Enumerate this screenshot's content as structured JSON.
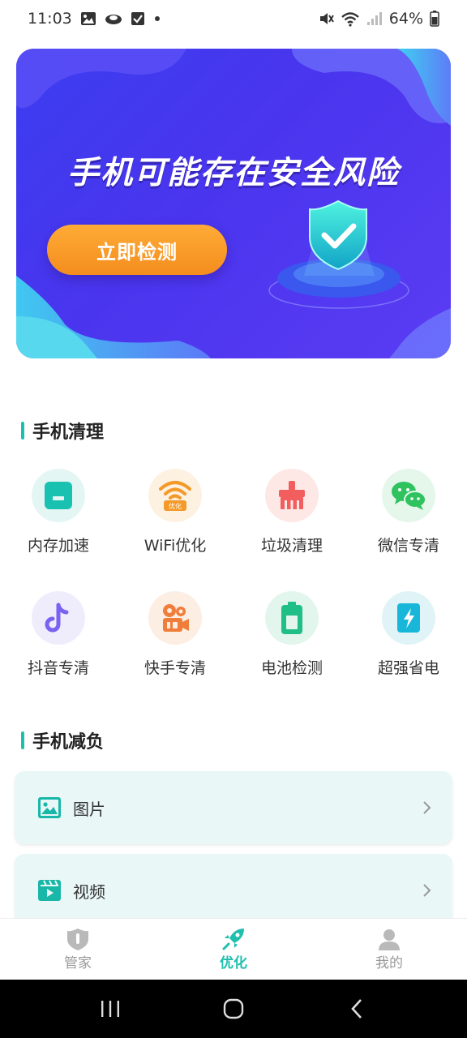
{
  "status_bar": {
    "time": "11:03",
    "battery_percent": "64%"
  },
  "banner": {
    "title": "手机可能存在安全风险",
    "button_label": "立即检测"
  },
  "sections": {
    "cleanup_title": "手机清理",
    "slim_title": "手机减负"
  },
  "tools": [
    {
      "label": "内存加速",
      "icon": "memory-icon",
      "color": "#19c2b0"
    },
    {
      "label": "WiFi优化",
      "icon": "wifi-icon",
      "color": "#f39a2a"
    },
    {
      "label": "垃圾清理",
      "icon": "broom-icon",
      "color": "#f25d5d"
    },
    {
      "label": "微信专清",
      "icon": "wechat-icon",
      "color": "#2ec35e"
    },
    {
      "label": "抖音专清",
      "icon": "tiktok-icon",
      "color": "#7a63f0"
    },
    {
      "label": "快手专清",
      "icon": "kuaishou-icon",
      "color": "#f07d3a"
    },
    {
      "label": "电池检测",
      "icon": "battery-icon",
      "color": "#1fbf86"
    },
    {
      "label": "超强省电",
      "icon": "power-save-icon",
      "color": "#18b6d8"
    }
  ],
  "tools_icon_text": {
    "wifi_badge": "优化"
  },
  "cards": [
    {
      "label": "图片",
      "icon": "image-icon"
    },
    {
      "label": "视频",
      "icon": "video-icon"
    }
  ],
  "bottom_nav": {
    "items": [
      {
        "label": "管家",
        "icon": "shield-icon"
      },
      {
        "label": "优化",
        "icon": "rocket-icon"
      },
      {
        "label": "我的",
        "icon": "user-icon"
      }
    ],
    "active": "优化"
  },
  "colors": {
    "accent": "#1fbfae",
    "banner": "#4a35ee",
    "banner_button": "#f48d1d",
    "card_bg": "#e9f7f6"
  }
}
